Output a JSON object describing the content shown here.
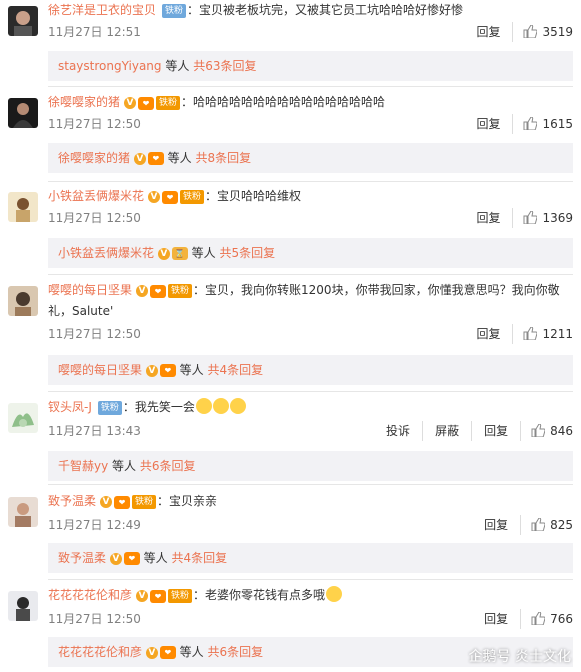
{
  "badges": {
    "fan": "铁粉"
  },
  "actions": {
    "reply": "回复",
    "report": "投诉",
    "block": "屏蔽"
  },
  "reply_suffix": "等人",
  "comments": [
    {
      "username": "徐艺洋是卫衣的宝贝",
      "text": "：宝贝被老板坑完，又被其它员工坑哈哈哈好惨好惨",
      "time": "11月27日 12:51",
      "likes": "3519",
      "reply_user": "staystrongYiyang",
      "reply_count": "共63条回复"
    },
    {
      "username": "徐嘤嘤家的猪",
      "text": "：哈哈哈哈哈哈哈哈哈哈哈哈哈哈哈哈",
      "time": "11月27日 12:50",
      "likes": "1615",
      "reply_user": "徐嘤嘤家的猪",
      "reply_count": "共8条回复"
    },
    {
      "username": "小铁盆丢俩爆米花",
      "text": "：宝贝哈哈哈维权",
      "time": "11月27日 12:50",
      "likes": "1369",
      "reply_user": "小铁盆丢俩爆米花",
      "reply_count": "共5条回复"
    },
    {
      "username": "嘤嘤的每日坚果",
      "text": "：宝贝，我向你转账1200块，你带我回家，你懂我意思吗？我向你敬礼，Salute'",
      "time": "11月27日 12:50",
      "likes": "1211",
      "reply_user": "嘤嘤的每日坚果",
      "reply_count": "共4条回复"
    },
    {
      "username": "钗头凤-J",
      "text": "：我先笑一会",
      "time": "11月27日 13:43",
      "likes": "846",
      "reply_user": "千智赫yy",
      "reply_count": "共6条回复"
    },
    {
      "username": "致予温柔",
      "text": "：宝贝亲亲",
      "time": "11月27日 12:49",
      "likes": "825",
      "reply_user": "致予温柔",
      "reply_count": "共4条回复"
    },
    {
      "username": "花花花花伦和彦",
      "text": "：老婆你零花钱有点多哦",
      "time": "11月27日 12:50",
      "likes": "766",
      "reply_user": "花花花花伦和彦",
      "reply_count": "共6条回复"
    }
  ],
  "watermark": "企鹅号 炎士文化"
}
